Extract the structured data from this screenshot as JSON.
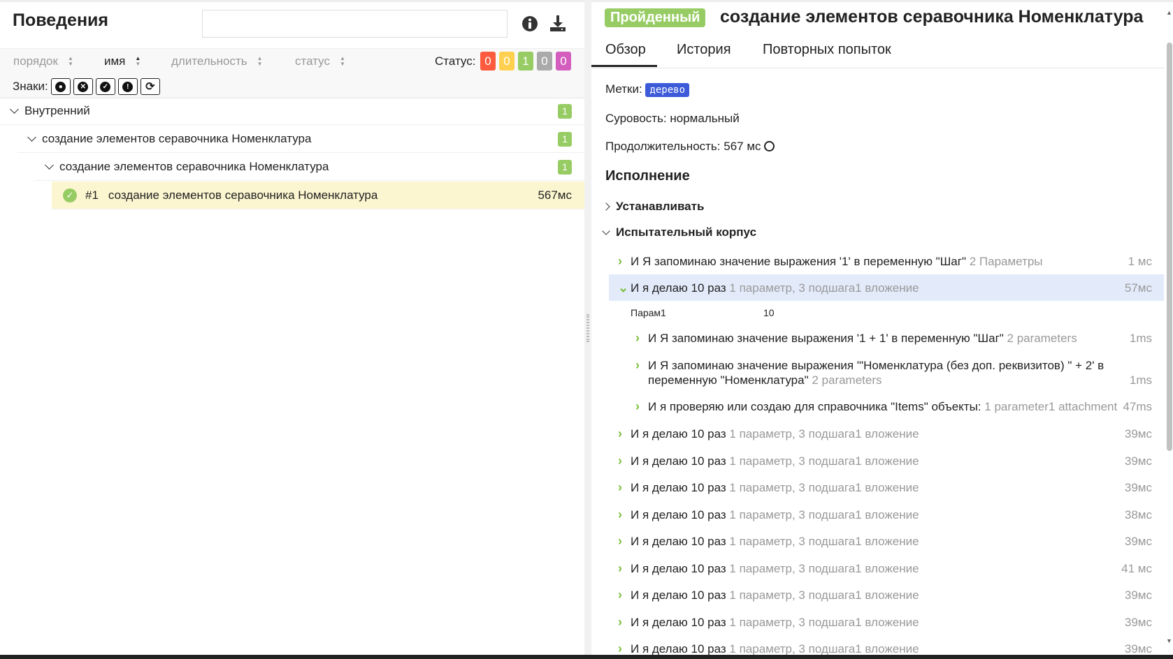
{
  "left": {
    "title": "Поведения",
    "search_placeholder": "",
    "sort": [
      {
        "label": "порядок"
      },
      {
        "label": "имя"
      },
      {
        "label": "длительность"
      },
      {
        "label": "статус"
      }
    ],
    "status_label": "Статус:",
    "status_counts": [
      {
        "value": "0",
        "color": "#fd5a3e"
      },
      {
        "value": "0",
        "color": "#ffd050"
      },
      {
        "value": "1",
        "color": "#97cc64"
      },
      {
        "value": "0",
        "color": "#aaaaaa"
      },
      {
        "value": "0",
        "color": "#d35ebe"
      }
    ],
    "signs_label": "Знаки:",
    "tree": [
      {
        "label": "Внутренний",
        "count": "1"
      },
      {
        "label": "создание элементов серавочника Номенклатура",
        "count": "1"
      },
      {
        "label": "создание элементов серавочника Номенклатура",
        "count": "1"
      }
    ],
    "selected": {
      "num": "#1",
      "label": "создание элементов серавочника Номенклатура",
      "duration": "567мс"
    }
  },
  "right": {
    "status": "Пройденный",
    "title": "создание элементов серавочника Номенклатура",
    "tabs": [
      "Обзор",
      "История",
      "Повторных попыток"
    ],
    "tags_label": "Метки:",
    "tag": "дерево",
    "severity": "Суровость: нормальный",
    "duration": "Продолжительность: 567 мс",
    "execution": "Исполнение",
    "setup": "Устанавливать",
    "body": "Испытательный корпус",
    "steps": [
      {
        "text": "И Я запоминаю значение выражения '1' в переменную \"Шаг\"",
        "meta": "2 Параметры",
        "dur": "1 мс"
      },
      {
        "text": "И я делаю 10 раз",
        "meta": "1 параметр, 3 подшага1 вложение",
        "dur": "57мс"
      }
    ],
    "param": {
      "name": "Парам1",
      "value": "10"
    },
    "substeps": [
      {
        "text": "И Я запоминаю значение выражения '1 + 1' в переменную \"Шаг\"",
        "meta": "2 parameters",
        "dur": "1ms"
      },
      {
        "text": "И Я запоминаю значение выражения '\"Номенклатура (без доп. реквизитов) \" + 2' в переменную \"Номенклатура\"",
        "meta": "2 parameters",
        "dur": "1ms"
      },
      {
        "text": "И я проверяю или создаю для справочника \"Items\" объекты:",
        "meta": "1 parameter1 attachment",
        "dur": "47ms"
      }
    ],
    "more_steps": [
      {
        "text": "И я делаю 10 раз",
        "meta": "1 параметр, 3 подшага1 вложение",
        "dur": "39мс"
      },
      {
        "text": "И я делаю 10 раз",
        "meta": "1 параметр, 3 подшага1 вложение",
        "dur": "39мс"
      },
      {
        "text": "И я делаю 10 раз",
        "meta": "1 параметр, 3 подшага1 вложение",
        "dur": "39мс"
      },
      {
        "text": "И я делаю 10 раз",
        "meta": "1 параметр, 3 подшага1 вложение",
        "dur": "38мс"
      },
      {
        "text": "И я делаю 10 раз",
        "meta": "1 параметр, 3 подшага1 вложение",
        "dur": "39мс"
      },
      {
        "text": "И я делаю 10 раз",
        "meta": "1 параметр, 3 подшага1 вложение",
        "dur": "41 мс"
      },
      {
        "text": "И я делаю 10 раз",
        "meta": "1 параметр, 3 подшага1 вложение",
        "dur": "39мс"
      },
      {
        "text": "И я делаю 10 раз",
        "meta": "1 параметр, 3 подшага1 вложение",
        "dur": "39мс"
      },
      {
        "text": "И я делаю 10 раз",
        "meta": "1 параметр, 3 подшага1 вложение",
        "dur": "39мс"
      }
    ]
  }
}
